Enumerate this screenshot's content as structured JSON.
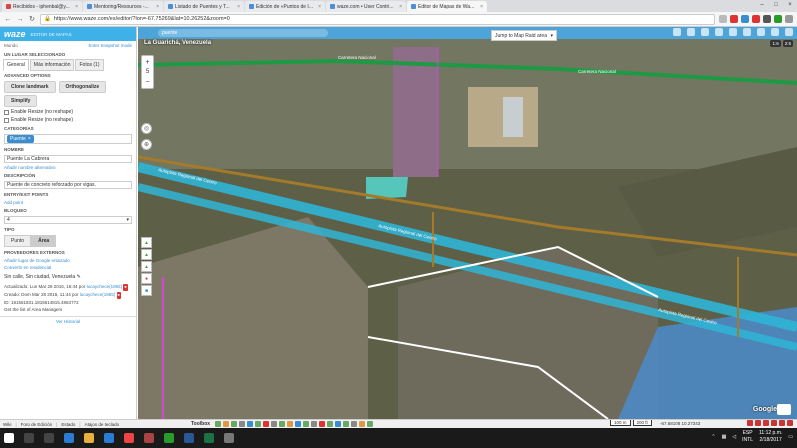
{
  "browser": {
    "tabs": [
      {
        "label": "Recibidos - iphenbal@y..."
      },
      {
        "label": "Mentoring/Resources -..."
      },
      {
        "label": "Listado de Puentes y T..."
      },
      {
        "label": "Edición de «Puntos de I..."
      },
      {
        "label": "waze.com • User Contri..."
      },
      {
        "label": "Editor de Mapas de Wa..."
      }
    ],
    "url": "https://www.waze.com/es/editor/?lon=-67.75269&lat=10.26252&zoom=0"
  },
  "side": {
    "logo": "waze",
    "logo_sub": "EDITOR DE MAPAS",
    "mundo": "Mundo",
    "enter_mode": "Enter Snapshot mode",
    "selected_title": "UN LUGAR SELECCIONADO",
    "tabs": [
      "General",
      "Más información",
      "Fotos (1)"
    ],
    "adv_title": "ADVANCED OPTIONS",
    "clone_label": "Clone landmark",
    "orthogonalize_label": "Orthogonalize",
    "simplify_label": "Simplify",
    "resize1": "Enable Resize (no reshape)",
    "resize2": "Enable Resize (no reshape)",
    "categorias_title": "CATEGORÍAS",
    "category_chip": "Puente",
    "nombre_title": "NOMBRE",
    "nombre_value": "Puente La Cabrera",
    "add_alt_name": "Añadir nombre alternativo",
    "descripcion_title": "DESCRIPCIÓN",
    "descripcion_value": "Puente de concreto reforzado por vigas.",
    "entry_title": "ENTRY/EXIT POINTS",
    "add_point": "Add point",
    "bloqueo_title": "BLOQUEO",
    "bloqueo_value": "4",
    "tipo_title": "TIPO",
    "tipo_punto": "Punto",
    "tipo_area": "Área",
    "providers_title": "PROVEEDORES EXTERNOS",
    "add_google": "Añadir lugar de Google enlazado",
    "convert": "Convertir en residencial",
    "address": "Sin calle, Sin ciudad, Venezuela",
    "updated": "Actualizado: Lun Mar 28 2016, 16:44 por",
    "updated_user": "lucaychece(1965)",
    "created": "Creado: Dom Mar 28 2016, 11:44 por",
    "created_user": "lucaychece(1965)",
    "id_line": "ID: 181561831.1815614815.4863772",
    "area_managers": "Get the list of Area Managers",
    "history": "Ver Historial"
  },
  "map": {
    "search_placeholder": "puente",
    "jump": "Jump to Map Raid area",
    "city": "La Guarichá, Venezuela",
    "zoom_level": "5",
    "coord_chips": [
      "1:6",
      "2:6"
    ],
    "google": "Google",
    "road_labels": [
      "Carretera Nacional",
      "Carretera Nacional",
      "Autopista Regional del Centro",
      "Autopista Regional del Centro",
      "Autopista Regional del Centro"
    ]
  },
  "status": {
    "items": [
      "Wiki",
      "Foro de Edición",
      "Estado",
      "Atajos de teclado"
    ],
    "toolbox": "Toolbox",
    "scale_m": "100 m",
    "scale_ft": "200 ft",
    "coords": "-67.68108 10.27343"
  },
  "taskbar": {
    "lang": "ESP",
    "lang2": "INTL",
    "time": "11:12 p.m.",
    "date": "2/18/2017"
  }
}
